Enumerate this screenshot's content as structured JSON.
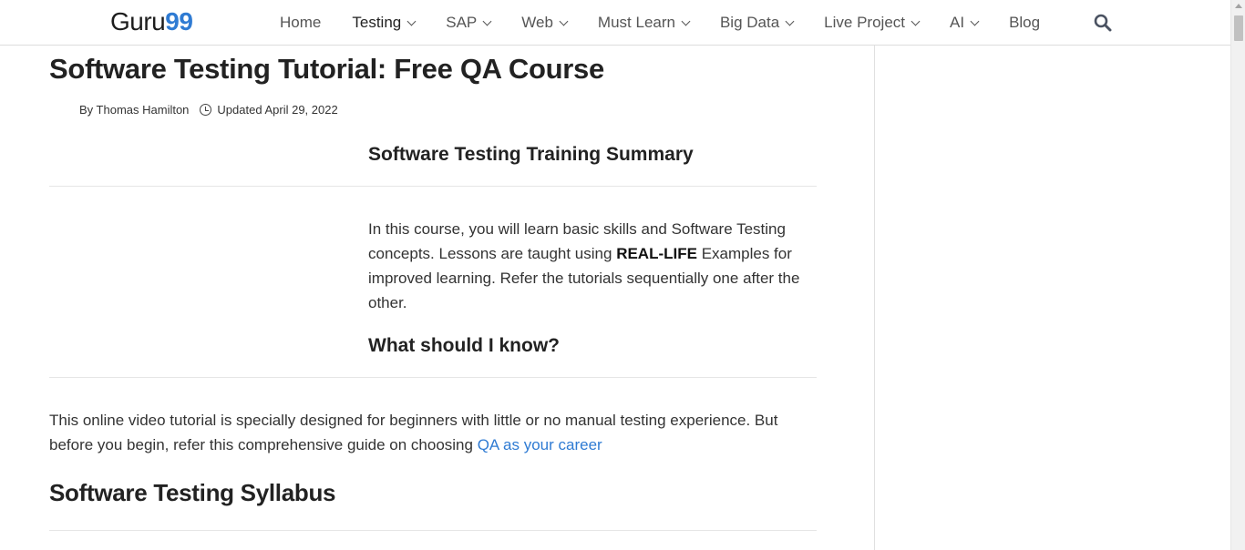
{
  "header": {
    "logo_part1": "Guru",
    "logo_part2": "99",
    "nav": [
      {
        "label": "Home"
      },
      {
        "label": "Testing"
      },
      {
        "label": "SAP"
      },
      {
        "label": "Web"
      },
      {
        "label": "Must Learn"
      },
      {
        "label": "Big Data"
      },
      {
        "label": "Live Project"
      },
      {
        "label": "AI"
      },
      {
        "label": "Blog"
      }
    ],
    "search_icon": "search-icon"
  },
  "article": {
    "title": "Software Testing Tutorial: Free QA Course",
    "author": "By Thomas Hamilton",
    "updated": "Updated April 29, 2022",
    "summary_heading": "Software Testing Training Summary",
    "intro_part1": "In this course, you will learn basic skills and Software Testing concepts. Lessons are taught using ",
    "intro_bold": "REAL-LIFE",
    "intro_part2": " Examples for improved learning. Refer the tutorials sequentially one after the other.",
    "know_heading": "What should I know?",
    "online_text": "This online video tutorial is specially designed for beginners with little or no manual testing experience. But before you begin, refer this comprehensive guide on choosing ",
    "online_link": "QA as your career",
    "syllabus_heading": "Software Testing Syllabus"
  },
  "colors": {
    "accent": "#2f7bd3",
    "text": "#222222"
  }
}
